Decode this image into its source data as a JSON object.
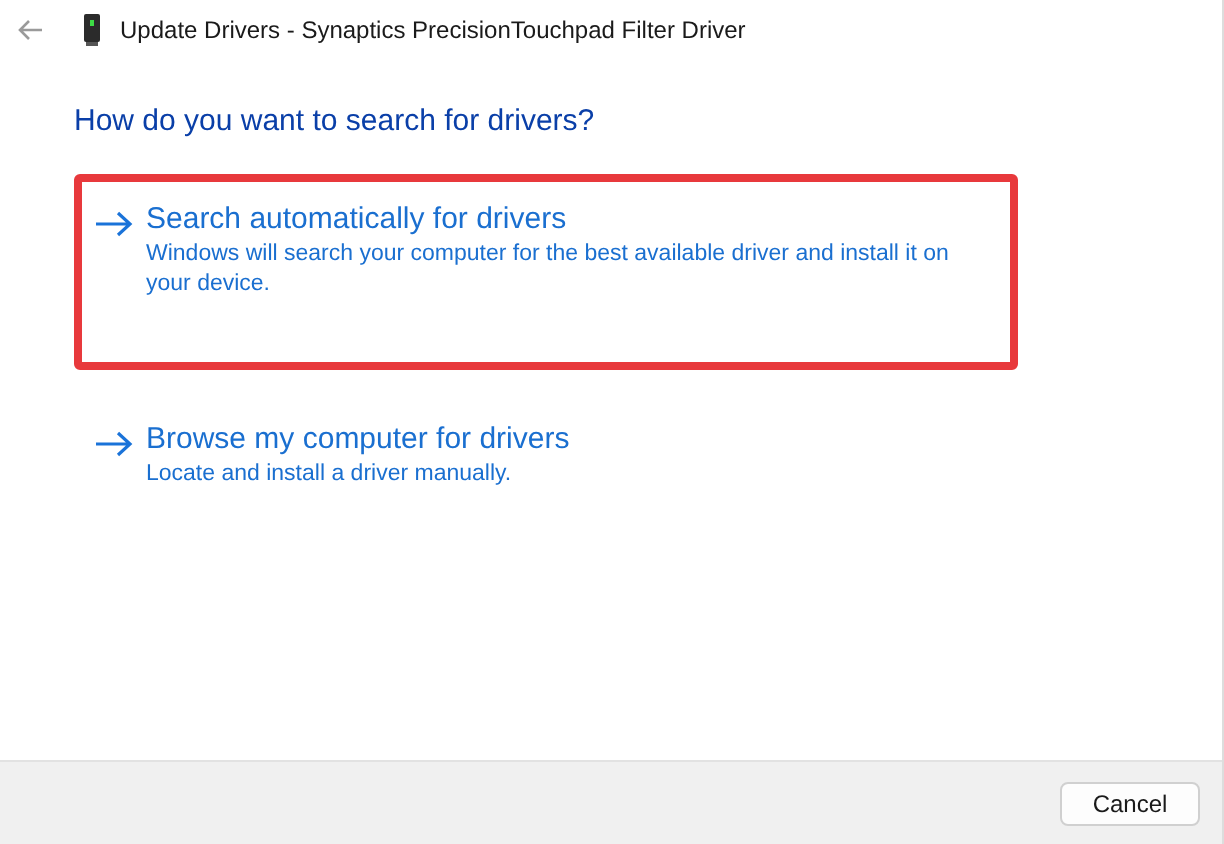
{
  "window": {
    "title": "Update Drivers - Synaptics PrecisionTouchpad Filter Driver"
  },
  "heading": "How do you want to search for drivers?",
  "options": [
    {
      "title": "Search automatically for drivers",
      "description": "Windows will search your computer for the best available driver and install it on your device.",
      "highlighted": true
    },
    {
      "title": "Browse my computer for drivers",
      "description": "Locate and install a driver manually.",
      "highlighted": false
    }
  ],
  "buttons": [
    "Cancel"
  ]
}
